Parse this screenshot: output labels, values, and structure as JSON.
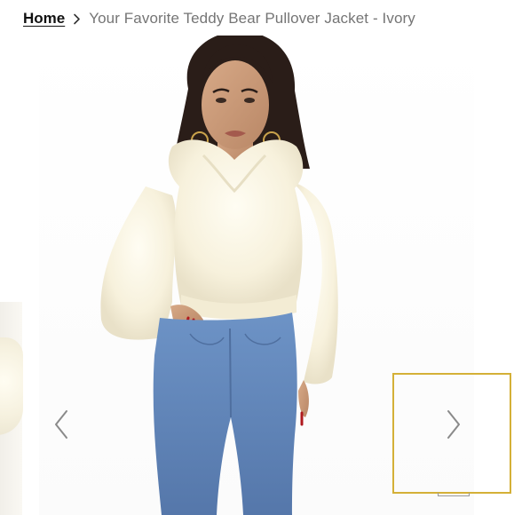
{
  "breadcrumb": {
    "home_label": "Home",
    "current_label": "Your Favorite Teddy Bear Pullover Jacket - Ivory",
    "separator_icon": "chevron-right-icon"
  },
  "gallery": {
    "prev_icon": "chevron-left-icon",
    "next_icon": "chevron-right-icon",
    "selected_thumb_border_color": "#d4b037",
    "arrow_color": "#8a8a8a"
  },
  "product": {
    "color_name": "Ivory",
    "jacket_color": "#f7f1dc",
    "jeans_color": "#6d93c6",
    "skin_color": "#c99a79",
    "hair_color": "#2a1d18",
    "nail_color": "#b0191e"
  }
}
